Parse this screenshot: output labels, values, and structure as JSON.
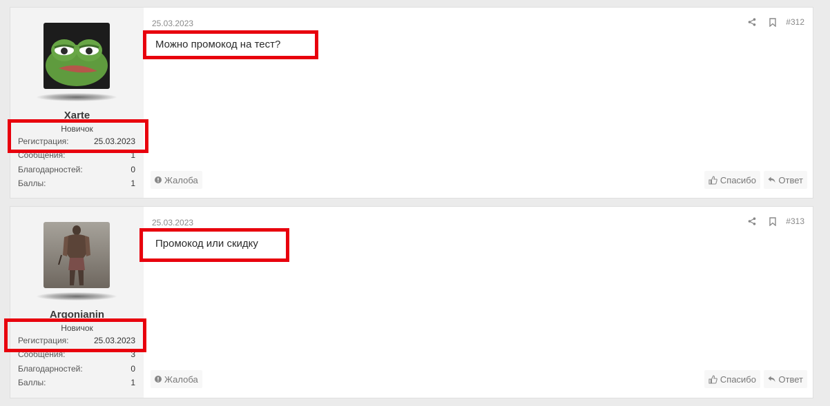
{
  "posts": [
    {
      "username": "Xarte",
      "rank": "Новичок",
      "registration_label": "Регистрация:",
      "registration_value": "25.03.2023",
      "messages_label": "Сообщения:",
      "messages_value": "1",
      "thanks_label": "Благодарностей:",
      "thanks_value": "0",
      "points_label": "Баллы:",
      "points_value": "1",
      "date": "25.03.2023",
      "post_number": "#312",
      "message": "Можно промокод на тест?",
      "report_label": "Жалоба",
      "like_label": "Спасибо",
      "reply_label": "Ответ"
    },
    {
      "username": "Argonianin",
      "rank": "Новичок",
      "registration_label": "Регистрация:",
      "registration_value": "25.03.2023",
      "messages_label": "Сообщения:",
      "messages_value": "3",
      "thanks_label": "Благодарностей:",
      "thanks_value": "0",
      "points_label": "Баллы:",
      "points_value": "1",
      "date": "25.03.2023",
      "post_number": "#313",
      "message": "Промокод или скидку",
      "report_label": "Жалоба",
      "like_label": "Спасибо",
      "reply_label": "Ответ"
    }
  ],
  "icons": {
    "share": "share-icon",
    "bookmark": "bookmark-icon",
    "report": "alert-circle-icon",
    "like": "thumbs-up-icon",
    "reply": "reply-icon"
  },
  "colors": {
    "highlight": "#e8000d",
    "user_column": "#f3f3f3",
    "post_background": "#ffffff",
    "page_background": "#ebebeb"
  }
}
